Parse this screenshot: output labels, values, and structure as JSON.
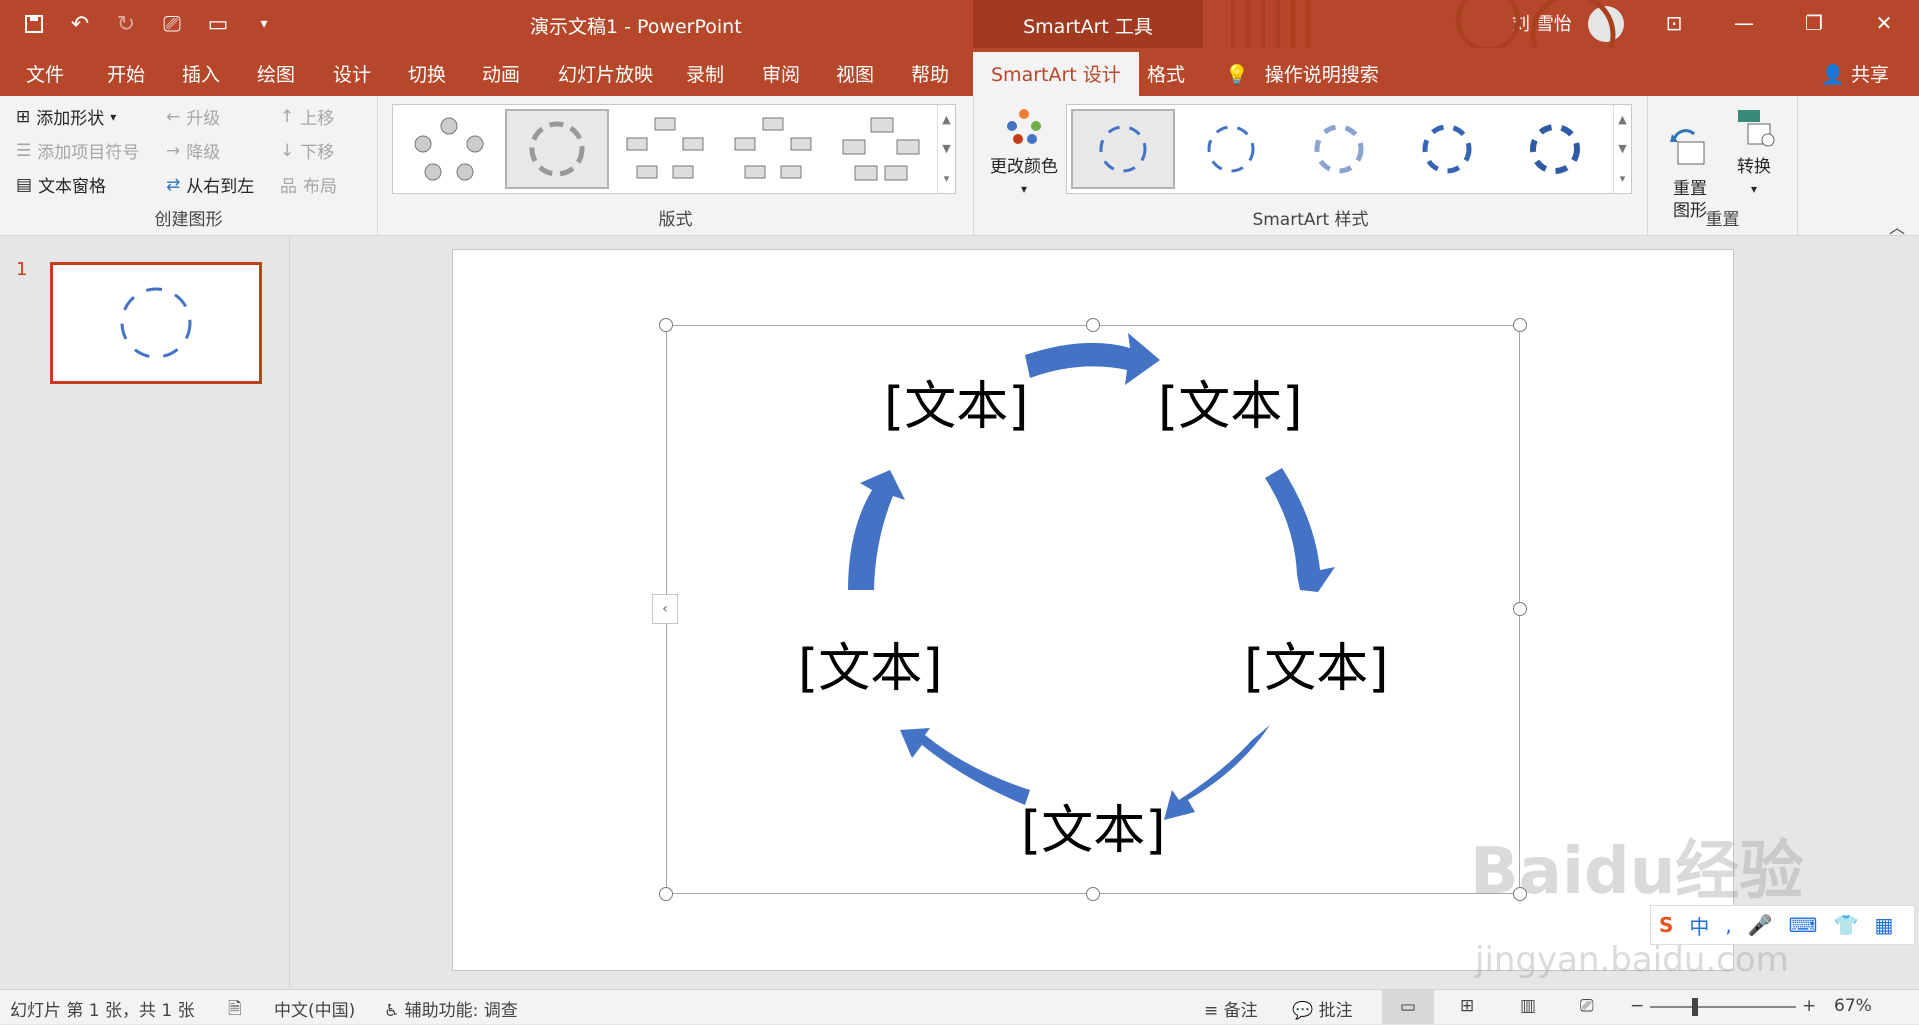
{
  "title_bar": {
    "doc_title": "演示文稿1  -  PowerPoint",
    "context_tools": "SmartArt 工具",
    "user_name": "刘 雪怡"
  },
  "tabs": [
    "文件",
    "开始",
    "插入",
    "绘图",
    "设计",
    "切换",
    "动画",
    "幻灯片放映",
    "录制",
    "审阅",
    "视图",
    "帮助"
  ],
  "active_tab": "SmartArt 设计",
  "format_tab": "格式",
  "tell_me": "操作说明搜索",
  "share": "共享",
  "ribbon": {
    "create_group": {
      "label": "创建图形",
      "add_shape": "添加形状",
      "add_bullet": "添加项目符号",
      "text_pane": "文本窗格",
      "promote": "升级",
      "demote": "降级",
      "right_to_left": "从右到左",
      "move_up": "上移",
      "move_down": "下移",
      "layout": "布局"
    },
    "layouts_group": {
      "label": "版式"
    },
    "styles_group": {
      "label": "SmartArt 样式",
      "change_colors": "更改颜色"
    },
    "reset_group": {
      "label": "重置",
      "reset_graphic": "重置\n图形",
      "convert": "转换"
    }
  },
  "slides_pane": {
    "slide_number": "1"
  },
  "smartart": {
    "nodes": [
      "[文本]",
      "[文本]",
      "[文本]",
      "[文本]",
      "[文本]"
    ],
    "arrow_color": "#4472c4"
  },
  "status_bar": {
    "slide_info": "幻灯片 第 1 张，共 1 张",
    "language": "中文(中国)",
    "accessibility": "辅助功能: 调查",
    "notes": "备注",
    "comments": "批注",
    "zoom": "67%"
  },
  "watermark": {
    "line1": "Baidu经验",
    "line2": "jingyan.baidu.com"
  }
}
